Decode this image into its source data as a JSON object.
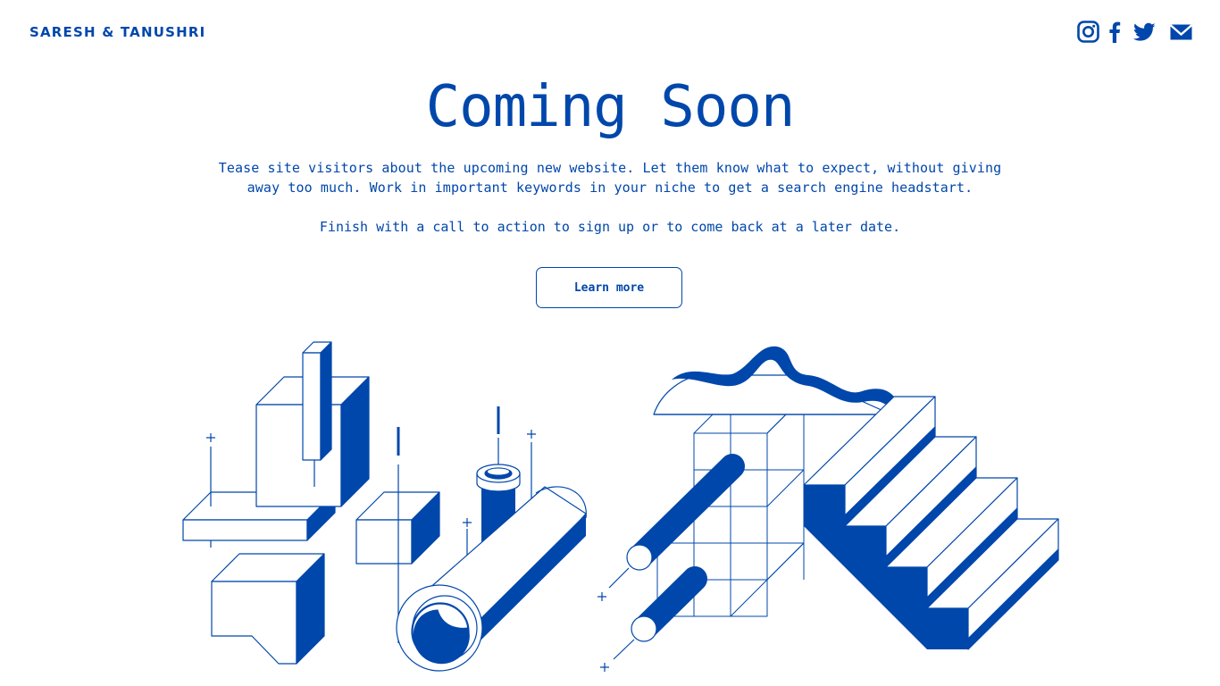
{
  "brand": {
    "name": "SARESH & TANUSHRI"
  },
  "social": {
    "icons": [
      "instagram-icon",
      "facebook-icon",
      "twitter-icon",
      "mail-icon"
    ]
  },
  "hero": {
    "title": "Coming Soon",
    "description": "Tease site visitors about the upcoming new website. Let them know what to expect, without giving away too much. Work in important keywords in your niche to get a search engine headstart.",
    "call_to_action": "Finish with a call to action to sign up or to come back at a later date.",
    "button_label": "Learn more"
  },
  "colors": {
    "accent": "#0047AB",
    "background": "#FFFFFF"
  }
}
